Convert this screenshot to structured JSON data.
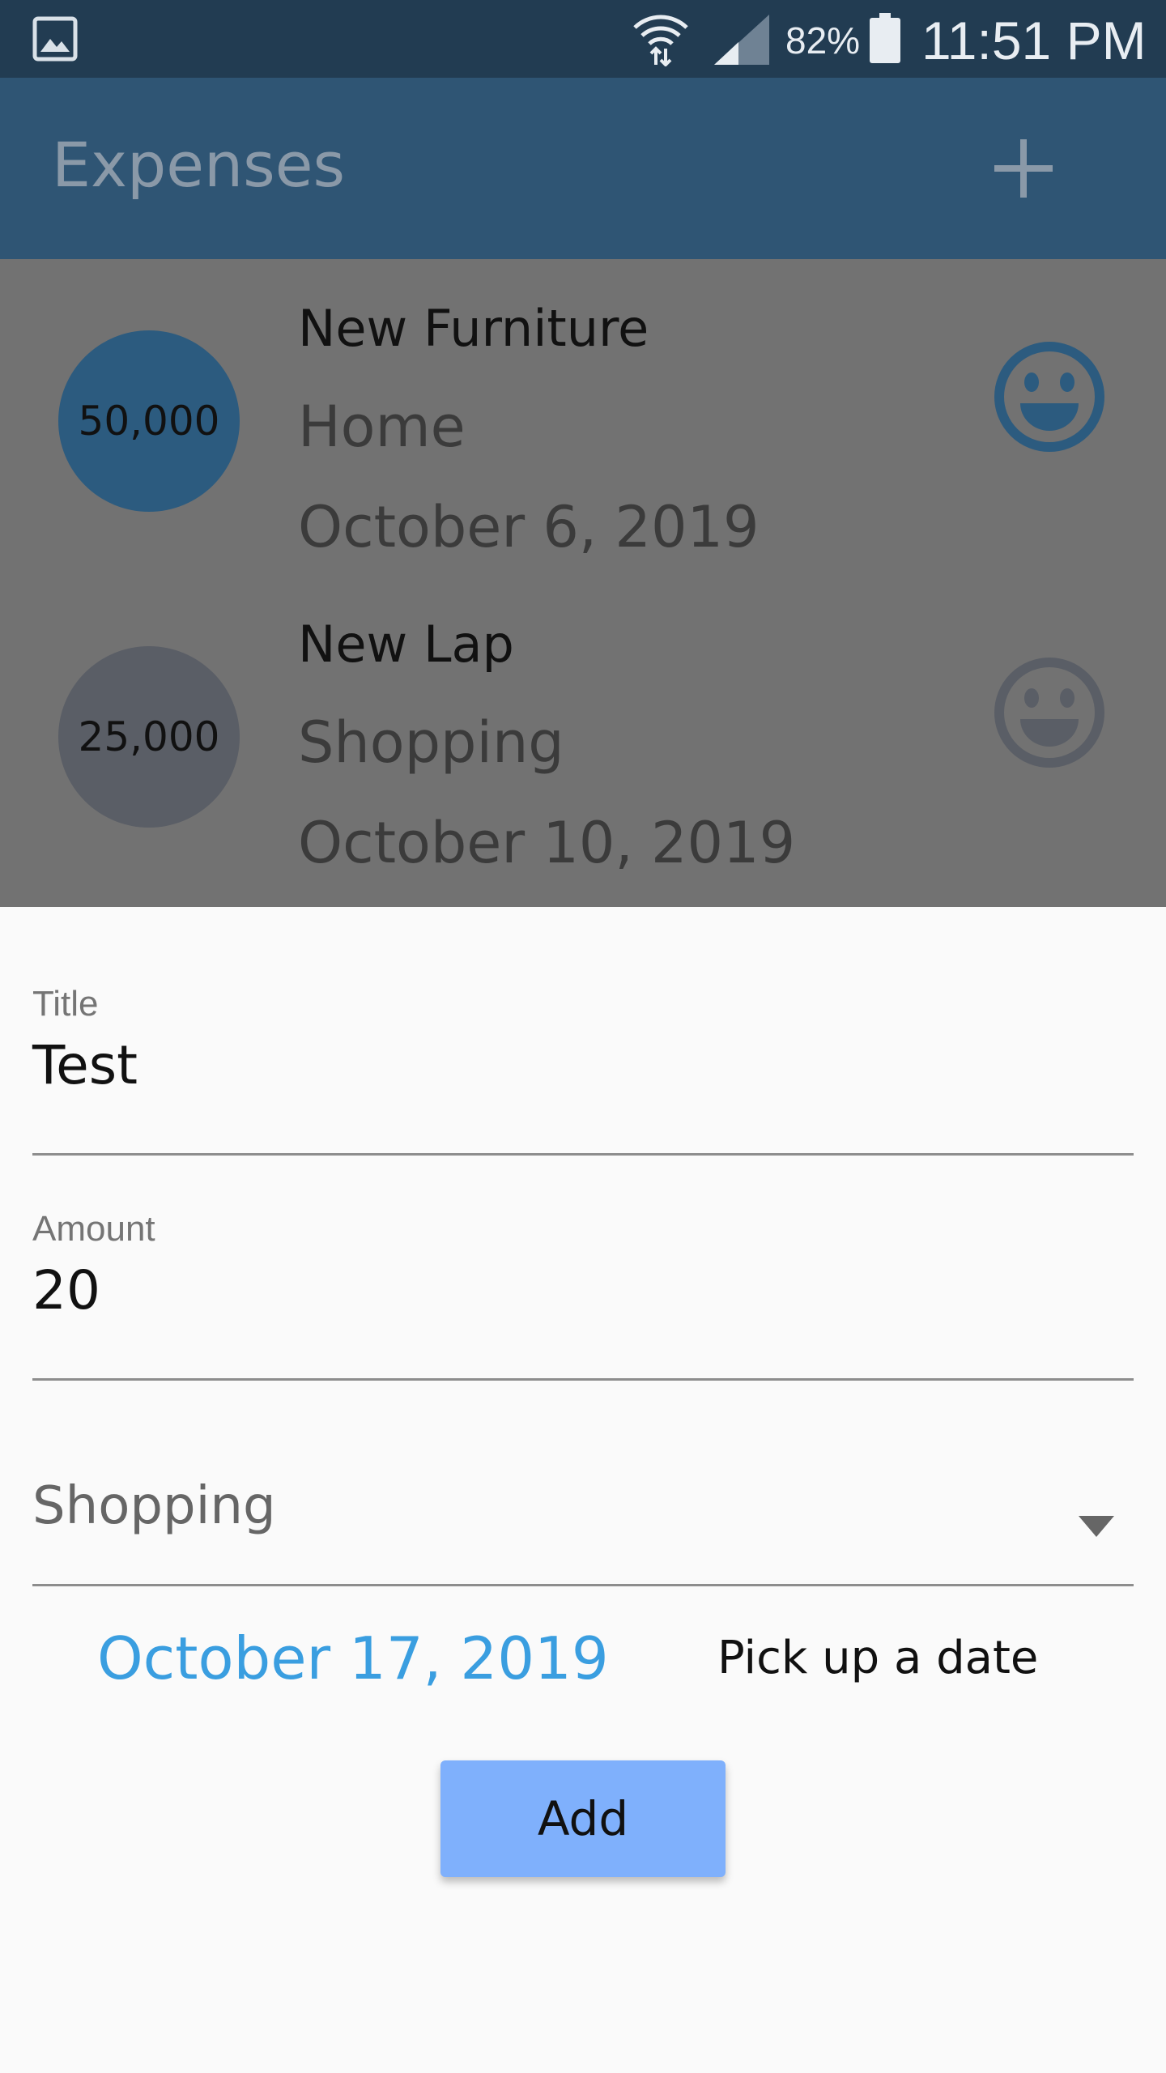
{
  "status_bar": {
    "battery_percent": "82%",
    "time": "11:51 PM",
    "icons": [
      "gallery-icon",
      "wifi-icon",
      "signal-icon",
      "battery-icon"
    ]
  },
  "appbar": {
    "title": "Expenses",
    "add_icon": "plus-icon"
  },
  "expenses": [
    {
      "amount": "50,000",
      "title": "New Furniture",
      "category": "Home",
      "date": "October 6, 2019",
      "circle_color": "#2c5b7f",
      "smiley_color": "#2c5b7f"
    },
    {
      "amount": "25,000",
      "title": "New Lap",
      "category": "Shopping",
      "date": "October 10, 2019",
      "circle_color": "#5a5e66",
      "smiley_color": "#5a5e66"
    }
  ],
  "form": {
    "title_label": "Title",
    "title_value": "Test",
    "amount_label": "Amount",
    "amount_value": "20",
    "category_value": "Shopping",
    "date_value": "October 17, 2019",
    "pick_date_label": "Pick up a date",
    "add_label": "Add"
  },
  "colors": {
    "status_bar": "#223c52",
    "appbar": "#2f5574",
    "accent_date": "#3a9ee0",
    "add_button": "#7fb0fc"
  }
}
